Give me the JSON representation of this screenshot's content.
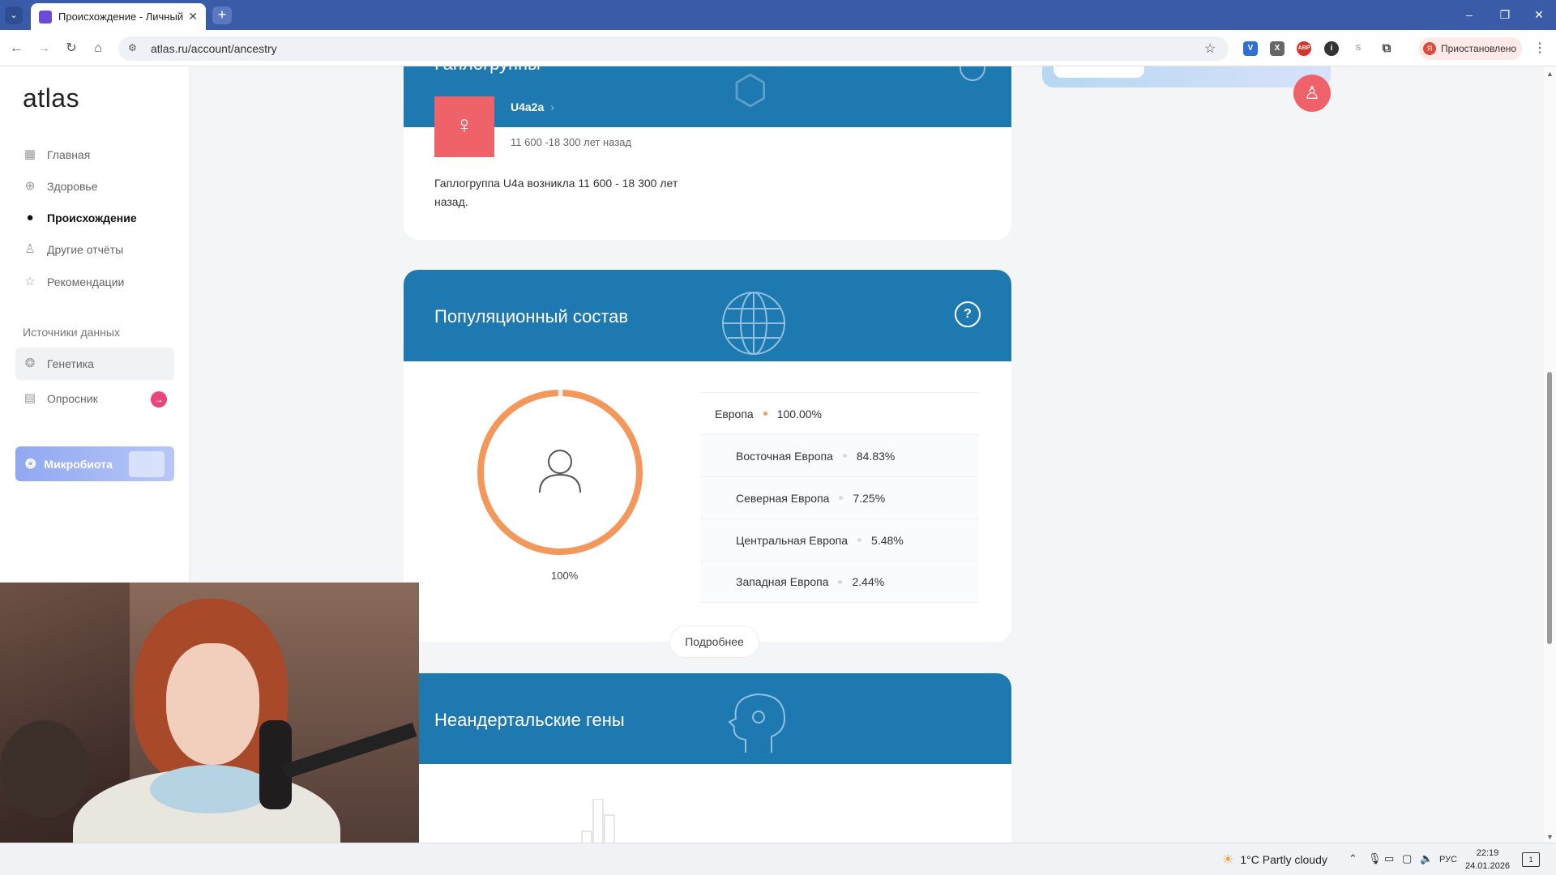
{
  "browser": {
    "tab_title": "Происхождение - Личный каб",
    "url": "atlas.ru/account/ancestry",
    "profile_status": "Приостановлено",
    "extensions": [
      "V",
      "X",
      "ABP",
      "i",
      "S"
    ]
  },
  "sidebar": {
    "logo": "atlas",
    "items": [
      {
        "label": "Главная",
        "icon": "grid-icon"
      },
      {
        "label": "Здоровье",
        "icon": "health-icon"
      },
      {
        "label": "Происхождение",
        "icon": "location-pin-icon",
        "active": true
      },
      {
        "label": "Другие отчёты",
        "icon": "person-icon"
      },
      {
        "label": "Рекомендации",
        "icon": "star-icon"
      }
    ],
    "sources_title": "Источники данных",
    "sources": [
      {
        "label": "Генетика",
        "icon": "dna-icon"
      },
      {
        "label": "Опросник",
        "icon": "clipboard-icon"
      }
    ],
    "microbiota_label": "Микробиота"
  },
  "haplogroup": {
    "header_partial": "Гаплогруппы",
    "code": "U4a2a",
    "time": "11 600 -18 300 лет назад",
    "description": "Гаплогруппа U4a возникла 11 600 - 18 300 лет назад."
  },
  "population": {
    "title": "Популяционный состав",
    "help": "?",
    "donut_label": "100%",
    "donut_fraction": 1.0,
    "accent": "#f4975a",
    "regions": [
      {
        "name": "Европа",
        "value": "100.00%",
        "top": true
      },
      {
        "name": "Восточная Европа",
        "value": "84.83%"
      },
      {
        "name": "Северная Европа",
        "value": "7.25%"
      },
      {
        "name": "Центральная Европа",
        "value": "5.48%"
      },
      {
        "name": "Западная Европа",
        "value": "2.44%"
      }
    ],
    "more_label": "Подробнее"
  },
  "neanderthal": {
    "title": "Неандертальские гены"
  },
  "taskbar": {
    "weather": "1°C  Partly cloudy",
    "lang": "РУС",
    "time": "22:19",
    "date": "24.01.2026",
    "notifications": "1"
  }
}
